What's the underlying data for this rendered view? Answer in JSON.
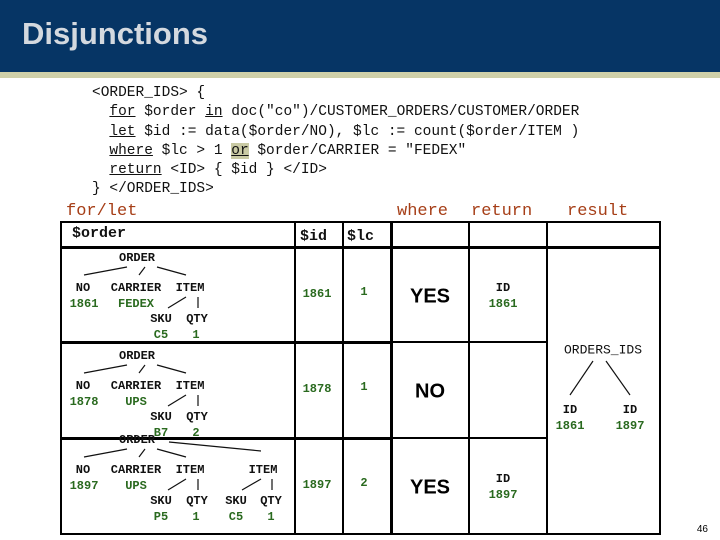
{
  "title": "Disjunctions",
  "code": {
    "l1": "<ORDER_IDS> {",
    "l2a": "for",
    "l2b": " $order ",
    "l2c": "in",
    "l2d": " doc(\"co\")/CUSTOMER_ORDERS/CUSTOMER/ORDER",
    "l3a": "let",
    "l3b": " $id := data($order/NO), $lc := count($order/ITEM )",
    "l4a": "where",
    "l4b": " $lc > 1 ",
    "l4c": "or",
    "l4d": " $order/CARRIER = \"FEDEX\"",
    "l5a": "return",
    "l5b": " <ID> { $id } </ID>",
    "l6": "} </ORDER_IDS>"
  },
  "headers": {
    "forlet": "for/let",
    "where": "where",
    "return": "return",
    "result": "result",
    "order": "$order",
    "id": "$id",
    "lc": "$lc"
  },
  "rows": [
    {
      "order": "ORDER",
      "no": "NO",
      "carrier": "CARRIER",
      "item": "ITEM",
      "no_val": "1861",
      "carrier_val": "FEDEX",
      "sku": "SKU",
      "qty": "QTY",
      "sku_val": "C5",
      "qty_val": "1",
      "id": "1861",
      "lc": "1",
      "where": "YES",
      "ret_tag": "ID",
      "ret_val": "1861"
    },
    {
      "order": "ORDER",
      "no": "NO",
      "carrier": "CARRIER",
      "item": "ITEM",
      "no_val": "1878",
      "carrier_val": "UPS",
      "sku": "SKU",
      "qty": "QTY",
      "sku_val": "B7",
      "qty_val": "2",
      "id": "1878",
      "lc": "1",
      "where": "NO"
    },
    {
      "order": "ORDER",
      "no": "NO",
      "carrier": "CARRIER",
      "item": "ITEM",
      "no_val": "1897",
      "carrier_val": "UPS",
      "sku": "SKU",
      "qty": "QTY",
      "sku_val": "P5",
      "qty_val": "1",
      "item2": "ITEM",
      "sku2": "SKU",
      "qty2": "QTY",
      "sku2_val": "C5",
      "qty2_val": "1",
      "id": "1897",
      "lc": "2",
      "where": "YES",
      "ret_tag": "ID",
      "ret_val": "1897"
    }
  ],
  "result": {
    "root": "ORDERS_IDS",
    "children": [
      {
        "tag": "ID",
        "val": "1861"
      },
      {
        "tag": "ID",
        "val": "1897"
      }
    ]
  },
  "page_number": "46"
}
